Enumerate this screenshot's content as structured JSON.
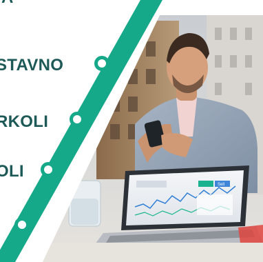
{
  "banner": {
    "top_fragment": "A",
    "labels": [
      {
        "text": "STAVNO"
      },
      {
        "text": "RKOLI"
      },
      {
        "text": "OLI"
      }
    ],
    "trading_tab": "Sell"
  },
  "colors": {
    "accent": "#15a98a",
    "text": "#1d5a57",
    "background": "#ffffff"
  },
  "icons": [
    "ring-bullet-icon"
  ]
}
